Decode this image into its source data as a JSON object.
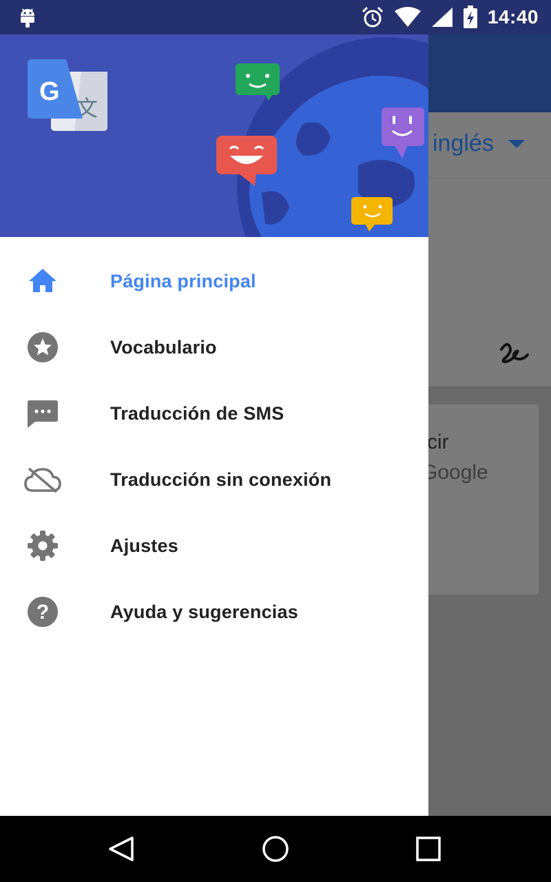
{
  "status_bar": {
    "time": "14:40",
    "icons": [
      "android-icon",
      "alarm-icon",
      "wifi-icon",
      "signal-icon",
      "battery-charging-icon"
    ]
  },
  "background_app": {
    "language_label": "inglés",
    "card_line1": "cir",
    "card_line2": "Google",
    "icons": [
      "handwriting-icon"
    ]
  },
  "drawer": {
    "header_icons": [
      "google-translate-logo",
      "globe-illustration",
      "chat-bubble-green",
      "chat-bubble-red",
      "chat-bubble-purple",
      "chat-bubble-yellow"
    ],
    "items": [
      {
        "label": "Página principal",
        "icon": "home-icon",
        "active": true
      },
      {
        "label": "Vocabulario",
        "icon": "star-icon",
        "active": false
      },
      {
        "label": "Traducción de SMS",
        "icon": "sms-icon",
        "active": false
      },
      {
        "label": "Traducción sin conexión",
        "icon": "cloud-off-icon",
        "active": false
      },
      {
        "label": "Ajustes",
        "icon": "settings-icon",
        "active": false
      },
      {
        "label": "Ayuda y sugerencias",
        "icon": "help-icon",
        "active": false
      }
    ]
  },
  "nav_bar": {
    "buttons": [
      "back-icon",
      "home-circle-icon",
      "recents-icon"
    ]
  },
  "colors": {
    "accent": "#4285f4",
    "status_bar": "#25306e",
    "drawer_header": "#3f51b5",
    "icon_gray": "#757575"
  }
}
